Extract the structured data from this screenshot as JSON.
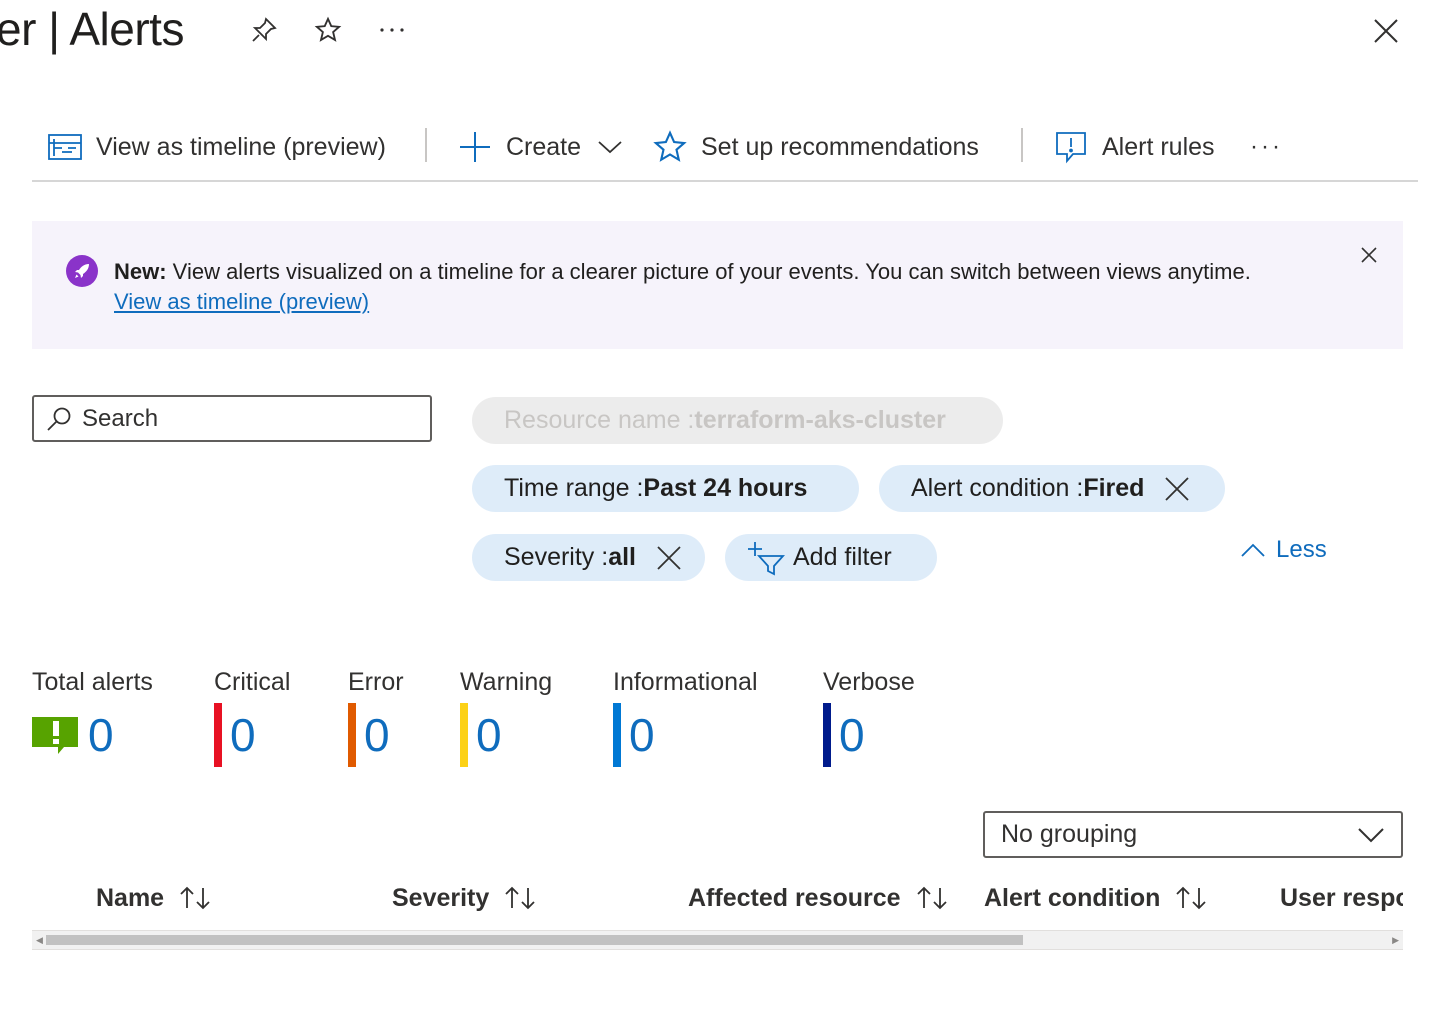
{
  "header": {
    "title": "er | Alerts",
    "pin_icon": "pin-icon",
    "favorite_icon": "star-icon",
    "more_icon": "ellipsis-icon",
    "close_icon": "close-icon"
  },
  "toolbar": {
    "timeline_label": "View as timeline (preview)",
    "create_label": "Create",
    "recommendations_label": "Set up recommendations",
    "alert_rules_label": "Alert rules",
    "more_label": "···"
  },
  "banner": {
    "bold": "New:",
    "text": " View alerts visualized on a timeline for a clearer picture of your events. You can switch between views anytime.",
    "link": "View as timeline (preview)",
    "icon_color": "#8a33c9",
    "background": "#f6f3fb"
  },
  "search": {
    "placeholder": "Search"
  },
  "filters": {
    "resource": {
      "label": "Resource name : ",
      "value": "terraform-aks-cluster"
    },
    "time_range": {
      "label": "Time range : ",
      "value": "Past 24 hours"
    },
    "alert_condition": {
      "label": "Alert condition : ",
      "value": "Fired"
    },
    "severity": {
      "label": "Severity : ",
      "value": "all"
    },
    "add_filter": "Add filter",
    "less": "Less"
  },
  "summary": [
    {
      "label": "Total alerts",
      "value": "0",
      "color": "#57a300"
    },
    {
      "label": "Critical",
      "value": "0",
      "color": "#e81123"
    },
    {
      "label": "Error",
      "value": "0",
      "color": "#e05a00"
    },
    {
      "label": "Warning",
      "value": "0",
      "color": "#fcd116"
    },
    {
      "label": "Informational",
      "value": "0",
      "color": "#0078d4"
    },
    {
      "label": "Verbose",
      "value": "0",
      "color": "#001b8c"
    }
  ],
  "grouping": {
    "selected": "No grouping"
  },
  "table": {
    "columns": [
      "Name",
      "Severity",
      "Affected resource",
      "Alert condition",
      "User respo"
    ]
  },
  "colors": {
    "accent": "#0f6cbd",
    "pill": "#deecf9"
  }
}
